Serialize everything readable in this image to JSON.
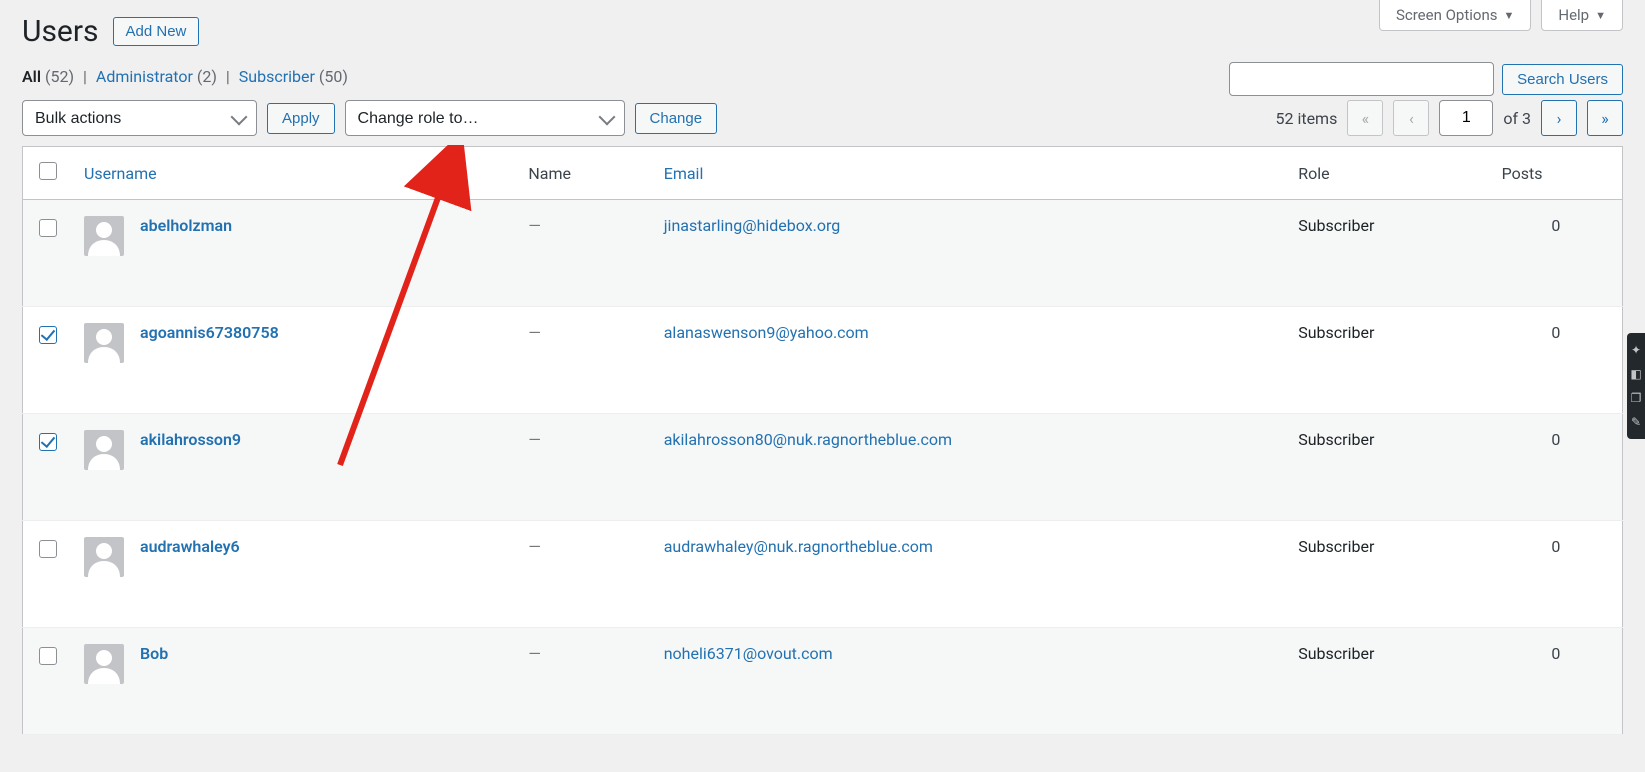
{
  "meta": {
    "screen_options_label": "Screen Options",
    "help_label": "Help"
  },
  "heading": {
    "title": "Users",
    "add_new_label": "Add New"
  },
  "filters": {
    "all_label": "All",
    "all_count": "(52)",
    "admin_label": "Administrator",
    "admin_count": "(2)",
    "sub_label": "Subscriber",
    "sub_count": "(50)"
  },
  "search": {
    "value": "",
    "button_label": "Search Users"
  },
  "actions": {
    "bulk_placeholder": "Bulk actions",
    "apply_label": "Apply",
    "role_placeholder": "Change role to…",
    "change_label": "Change"
  },
  "pagination": {
    "items_text": "52 items",
    "current_page": "1",
    "of_text": "of 3"
  },
  "columns": {
    "username": "Username",
    "name": "Name",
    "email": "Email",
    "role": "Role",
    "posts": "Posts"
  },
  "rows": [
    {
      "checked": false,
      "username": "abelholzman",
      "name": "—",
      "email": "jinastarling@hidebox.org",
      "role": "Subscriber",
      "posts": "0"
    },
    {
      "checked": true,
      "username": "agoannis67380758",
      "name": "—",
      "email": "alanaswenson9@yahoo.com",
      "role": "Subscriber",
      "posts": "0"
    },
    {
      "checked": true,
      "username": "akilahrosson9",
      "name": "—",
      "email": "akilahrosson80@nuk.ragnortheblue.com",
      "role": "Subscriber",
      "posts": "0"
    },
    {
      "checked": false,
      "username": "audrawhaley6",
      "name": "—",
      "email": "audrawhaley@nuk.ragnortheblue.com",
      "role": "Subscriber",
      "posts": "0"
    },
    {
      "checked": false,
      "username": "Bob",
      "name": "—",
      "email": "noheli6371@ovout.com",
      "role": "Subscriber",
      "posts": "0"
    }
  ]
}
